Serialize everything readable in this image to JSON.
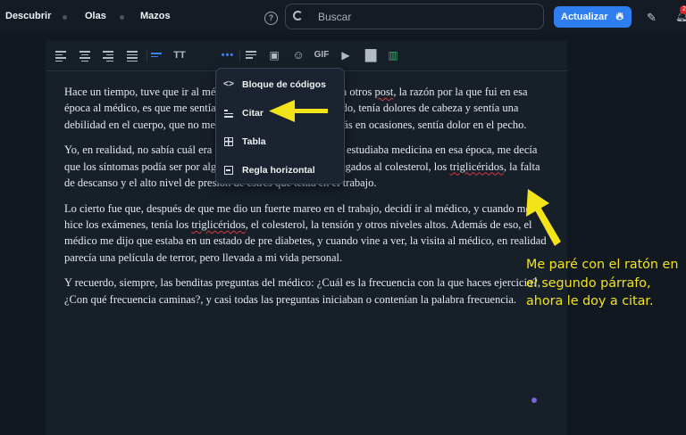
{
  "nav": {
    "items": [
      {
        "label": "Descubrir"
      },
      {
        "label": "Olas"
      },
      {
        "label": "Mazos"
      }
    ],
    "search": {
      "placeholder": "Buscar",
      "value": ""
    },
    "update_button": {
      "label": "Actualizar"
    },
    "notification_count": "2",
    "icons": [
      "help-icon",
      "search-icon",
      "flame-icon",
      "edit-icon",
      "bell-icon"
    ]
  },
  "toolbar": {
    "tools": [
      "align-left",
      "align-center",
      "align-right",
      "align-justify",
      "text-format",
      "text-size",
      "more",
      "list",
      "image",
      "emoji",
      "gif",
      "video",
      "chart",
      "map"
    ],
    "gif_label": "GIF",
    "text_size_label": "TT",
    "active_color": "#3d82f0"
  },
  "menu": {
    "items": [
      {
        "icon": "code-icon",
        "label": "Bloque de códigos"
      },
      {
        "icon": "quote-icon",
        "label": "Citar"
      },
      {
        "icon": "table-icon",
        "label": "Tabla"
      },
      {
        "icon": "horizontal-rule-icon",
        "label": "Regla horizontal"
      }
    ]
  },
  "content": {
    "p1": {
      "a": "Hace un tiempo, tuve que ir al médico, ya le conté sobre eso en otros ",
      "spell": "post",
      "b": ", la razón por la que fui en esa época al médico, es que me sentía muy mal, estaba muy cansado, tenía dolores de cabeza y sentía una debilidad en el cuerpo, que no me provocara hacer nada, además en ocasiones, sentía dolor en el pecho."
    },
    "p2": {
      "a": "Yo, en realidad, no sabía cuál era la causa, pero una amiga que estudiaba medicina en esa época, me decía que los síntomas podía ser por algún tipo de problema físico, ligados al colesterol, los ",
      "spell": "triglicéridos",
      "b": ", la falta de descanso y el alto nivel de presión de estrés que tenía en el trabajo."
    },
    "p3": {
      "a": "Lo cierto fue que, después de que me dio un fuerte mareo en el trabajo, decidí ir al médico, y cuando me hice los exámenes, tenía los ",
      "spell": "triglicéridos",
      "b": ", el colesterol, la tensión y otros niveles altos. Además de eso, el médico me dijo que estaba en un estado de pre diabetes, y cuando vine a ver, la visita al médico, en realidad parecía una película de terror, pero llevada a mi vida personal."
    },
    "p4": "Y recuerdo, siempre, las benditas preguntas del médico: ¿Cuál es la frecuencia con la que haces ejercicio?, ¿Con qué frecuencia caminas?, y casi todas las preguntas iniciaban o contenían la palabra frecuencia."
  },
  "annotation": {
    "text": "Me paré con el ratón en el segundo párrafo, ahora le doy a citar.",
    "color": "#f3e31b"
  }
}
